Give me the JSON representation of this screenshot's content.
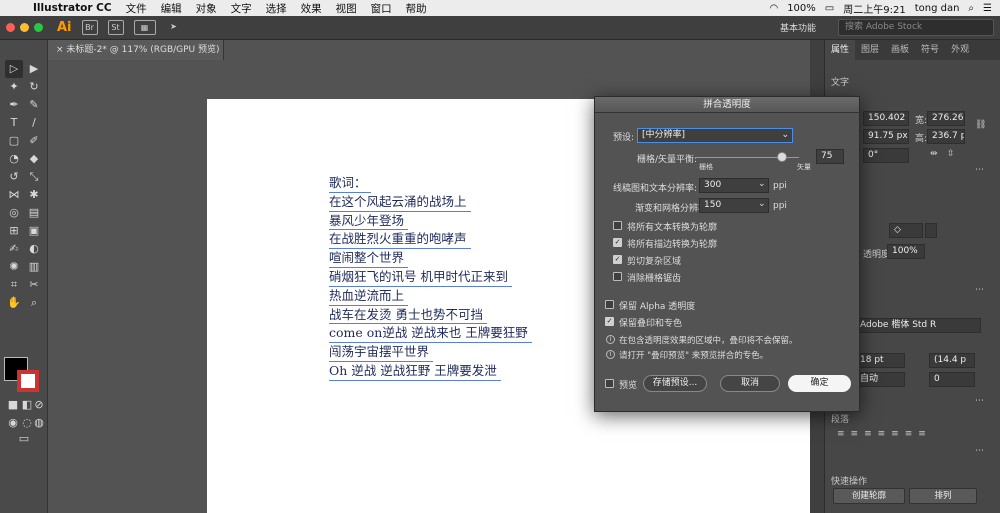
{
  "menubar": {
    "app": "Illustrator CC",
    "items": [
      "文件",
      "编辑",
      "对象",
      "文字",
      "选择",
      "效果",
      "视图",
      "窗口",
      "帮助"
    ],
    "battery": "100%",
    "clock": "周二上午9:21",
    "user": "tong dan"
  },
  "appbar": {
    "logo": "Ai",
    "btn_br": "Br",
    "btn_st": "St",
    "workspace": "基本功能",
    "search_placeholder": "搜索 Adobe Stock"
  },
  "doc_tab": "未标题-2* @ 117% (RGB/GPU 预览)",
  "lyrics": [
    "歌词：",
    "在这个风起云涌的战场上",
    "暴风少年登场",
    "在战胜烈火重重的咆哮声",
    "喧闹整个世界",
    "硝烟狂飞的讯号 机甲时代正来到",
    "热血逆流而上",
    "战车在发烫 勇士也势不可挡",
    "come on逆战 逆战来也 王牌要狂野",
    "闯荡宇宙摆平世界",
    "Oh 逆战 逆战狂野 王牌要发泄"
  ],
  "right_panel": {
    "tabs": [
      "属性",
      "图层",
      "画板",
      "符号",
      "外观"
    ],
    "section_text": "文字",
    "x": "150.402",
    "w_label": "宽:",
    "w": "276.263",
    "y": "91.75 px",
    "h_label": "高:",
    "h": "236.7 px",
    "angle": "0°",
    "opacity_label": "透明度",
    "opacity": "100%",
    "font": "Adobe 楷体 Std R",
    "font_size": "18 pt",
    "leading": "(14.4 p",
    "tracking_auto": "自动",
    "tracking": "0",
    "para_label": "段落",
    "quick_label": "快速操作",
    "outline_btn": "创建轮廓",
    "arrange_btn": "排列"
  },
  "dialog": {
    "title": "拼合透明度",
    "preset_label": "预设:",
    "preset_value": "[中分辨率]",
    "balance_label": "栅格/矢量平衡:",
    "balance_value": "75",
    "raster_label": "栅格",
    "vector_label": "矢量",
    "line_res_label": "线稿图和文本分辨率:",
    "line_res_value": "300",
    "gradient_res_label": "渐变和网格分辨率:",
    "gradient_res_value": "150",
    "ppi": "ppi",
    "checks": [
      {
        "label": "将所有文本转换为轮廓",
        "checked": false
      },
      {
        "label": "将所有描边转换为轮廓",
        "checked": true
      },
      {
        "label": "剪切复杂区域",
        "checked": true
      },
      {
        "label": "消除栅格锯齿",
        "checked": false
      }
    ],
    "alpha_label": "保留 Alpha 透明度",
    "alpha_checked": false,
    "overprint_label": "保留叠印和专色",
    "overprint_checked": true,
    "info1": "在包含透明度效果的区域中，叠印将不会保留。",
    "info2": "请打开 \"叠印预览\" 来预览拼合的专色。",
    "preview_label": "预览",
    "save_preset": "存储预设...",
    "cancel": "取消",
    "ok": "确定"
  }
}
